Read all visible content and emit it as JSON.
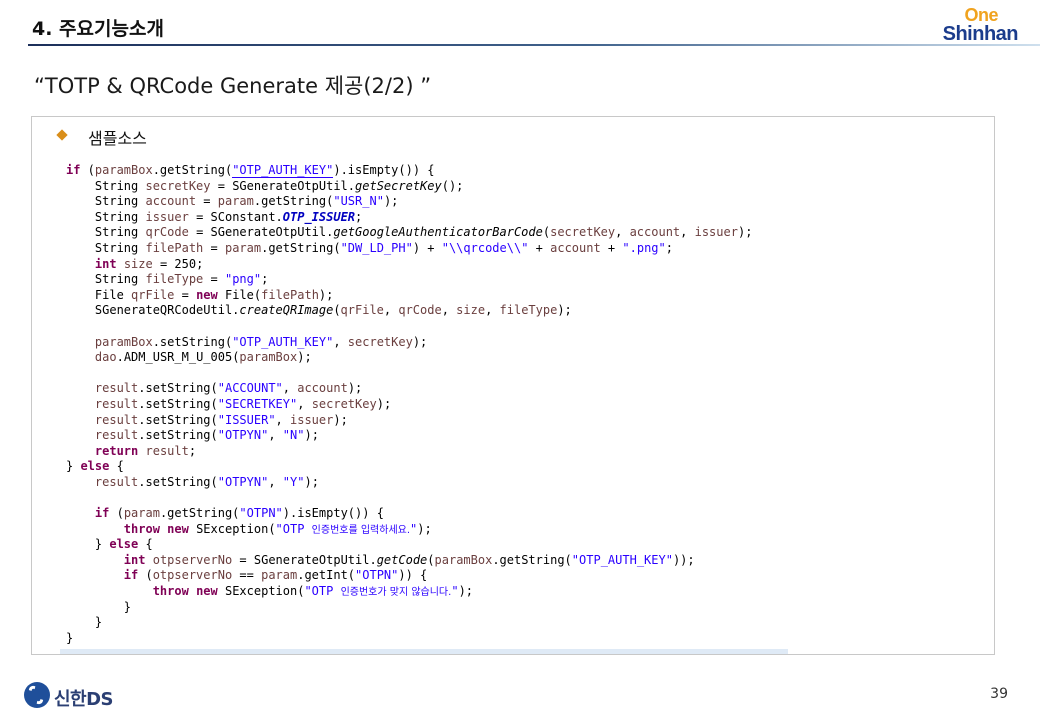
{
  "header": {
    "title": "4. 주요기능소개",
    "brand_one": "One",
    "brand_shinhan": "Shinhan"
  },
  "subtitle": "“TOTP & QRCode Generate 제공(2/2) ”",
  "section": {
    "label": "샘플소스"
  },
  "code_lines": [
    [
      [
        "kw",
        "if"
      ],
      [
        "p",
        " ("
      ],
      [
        "v",
        "paramBox"
      ],
      [
        "p",
        ".getString("
      ],
      [
        "sh",
        "\"OTP_AUTH_KEY\""
      ],
      [
        "p",
        ").isEmpty()) {"
      ]
    ],
    [
      [
        "p",
        "    String "
      ],
      [
        "v",
        "secretKey"
      ],
      [
        "p",
        " = SGenerateOtpUtil."
      ],
      [
        "i",
        "getSecretKey"
      ],
      [
        "p",
        "();"
      ]
    ],
    [
      [
        "p",
        "    String "
      ],
      [
        "v",
        "account"
      ],
      [
        "p",
        " = "
      ],
      [
        "v",
        "param"
      ],
      [
        "p",
        ".getString("
      ],
      [
        "s",
        "\"USR_N\""
      ],
      [
        "p",
        ");"
      ]
    ],
    [
      [
        "p",
        "    String "
      ],
      [
        "v",
        "issuer"
      ],
      [
        "p",
        " = SConstant."
      ],
      [
        "f",
        "OTP_ISSUER"
      ],
      [
        "p",
        ";"
      ]
    ],
    [
      [
        "p",
        "    String "
      ],
      [
        "v",
        "qrCode"
      ],
      [
        "p",
        " = SGenerateOtpUtil."
      ],
      [
        "i",
        "getGoogleAuthenticatorBarCode"
      ],
      [
        "p",
        "("
      ],
      [
        "v",
        "secretKey"
      ],
      [
        "p",
        ", "
      ],
      [
        "v",
        "account"
      ],
      [
        "p",
        ", "
      ],
      [
        "v",
        "issuer"
      ],
      [
        "p",
        ");"
      ]
    ],
    [
      [
        "p",
        "    String "
      ],
      [
        "v",
        "filePath"
      ],
      [
        "p",
        " = "
      ],
      [
        "v",
        "param"
      ],
      [
        "p",
        ".getString("
      ],
      [
        "s",
        "\"DW_LD_PH\""
      ],
      [
        "p",
        ") + "
      ],
      [
        "s",
        "\"\\\\qrcode\\\\\""
      ],
      [
        "p",
        " + "
      ],
      [
        "v",
        "account"
      ],
      [
        "p",
        " + "
      ],
      [
        "s",
        "\".png\""
      ],
      [
        "p",
        ";"
      ]
    ],
    [
      [
        "p",
        "    "
      ],
      [
        "kw",
        "int"
      ],
      [
        "p",
        " "
      ],
      [
        "v",
        "size"
      ],
      [
        "p",
        " = 250;"
      ]
    ],
    [
      [
        "p",
        "    String "
      ],
      [
        "v",
        "fileType"
      ],
      [
        "p",
        " = "
      ],
      [
        "s",
        "\"png\""
      ],
      [
        "p",
        ";"
      ]
    ],
    [
      [
        "p",
        "    File "
      ],
      [
        "v",
        "qrFile"
      ],
      [
        "p",
        " = "
      ],
      [
        "kw",
        "new"
      ],
      [
        "p",
        " File("
      ],
      [
        "v",
        "filePath"
      ],
      [
        "p",
        ");"
      ]
    ],
    [
      [
        "p",
        "    SGenerateQRCodeUtil."
      ],
      [
        "i",
        "createQRImage"
      ],
      [
        "p",
        "("
      ],
      [
        "v",
        "qrFile"
      ],
      [
        "p",
        ", "
      ],
      [
        "v",
        "qrCode"
      ],
      [
        "p",
        ", "
      ],
      [
        "v",
        "size"
      ],
      [
        "p",
        ", "
      ],
      [
        "v",
        "fileType"
      ],
      [
        "p",
        ");"
      ]
    ],
    [],
    [
      [
        "p",
        "    "
      ],
      [
        "v",
        "paramBox"
      ],
      [
        "p",
        ".setString("
      ],
      [
        "s",
        "\"OTP_AUTH_KEY\""
      ],
      [
        "p",
        ", "
      ],
      [
        "v",
        "secretKey"
      ],
      [
        "p",
        ");"
      ]
    ],
    [
      [
        "p",
        "    "
      ],
      [
        "v",
        "dao"
      ],
      [
        "p",
        ".ADM_USR_M_U_005("
      ],
      [
        "v",
        "paramBox"
      ],
      [
        "p",
        ");"
      ]
    ],
    [],
    [
      [
        "p",
        "    "
      ],
      [
        "v",
        "result"
      ],
      [
        "p",
        ".setString("
      ],
      [
        "s",
        "\"ACCOUNT\""
      ],
      [
        "p",
        ", "
      ],
      [
        "v",
        "account"
      ],
      [
        "p",
        ");"
      ]
    ],
    [
      [
        "p",
        "    "
      ],
      [
        "v",
        "result"
      ],
      [
        "p",
        ".setString("
      ],
      [
        "s",
        "\"SECRETKEY\""
      ],
      [
        "p",
        ", "
      ],
      [
        "v",
        "secretKey"
      ],
      [
        "p",
        ");"
      ]
    ],
    [
      [
        "p",
        "    "
      ],
      [
        "v",
        "result"
      ],
      [
        "p",
        ".setString("
      ],
      [
        "s",
        "\"ISSUER\""
      ],
      [
        "p",
        ", "
      ],
      [
        "v",
        "issuer"
      ],
      [
        "p",
        ");"
      ]
    ],
    [
      [
        "p",
        "    "
      ],
      [
        "v",
        "result"
      ],
      [
        "p",
        ".setString("
      ],
      [
        "s",
        "\"OTPYN\""
      ],
      [
        "p",
        ", "
      ],
      [
        "s",
        "\"N\""
      ],
      [
        "p",
        ");"
      ]
    ],
    [
      [
        "p",
        "    "
      ],
      [
        "kw",
        "return"
      ],
      [
        "p",
        " "
      ],
      [
        "v",
        "result"
      ],
      [
        "p",
        ";"
      ]
    ],
    [
      [
        "p",
        "} "
      ],
      [
        "kw",
        "else"
      ],
      [
        "p",
        " {"
      ]
    ],
    [
      [
        "p",
        "    "
      ],
      [
        "v",
        "result"
      ],
      [
        "p",
        ".setString("
      ],
      [
        "s",
        "\"OTPYN\""
      ],
      [
        "p",
        ", "
      ],
      [
        "s",
        "\"Y\""
      ],
      [
        "p",
        ");"
      ]
    ],
    [],
    [
      [
        "p",
        "    "
      ],
      [
        "kw",
        "if"
      ],
      [
        "p",
        " ("
      ],
      [
        "v",
        "param"
      ],
      [
        "p",
        ".getString("
      ],
      [
        "s",
        "\"OTPN\""
      ],
      [
        "p",
        ").isEmpty()) {"
      ]
    ],
    [
      [
        "p",
        "        "
      ],
      [
        "kw",
        "throw"
      ],
      [
        "p",
        " "
      ],
      [
        "kw",
        "new"
      ],
      [
        "p",
        " SException("
      ],
      [
        "s",
        "\"OTP "
      ],
      [
        "sk",
        "인증번호를 입력하세요."
      ],
      [
        "s",
        "\""
      ],
      [
        "p",
        ");"
      ]
    ],
    [
      [
        "p",
        "    } "
      ],
      [
        "kw",
        "else"
      ],
      [
        "p",
        " {"
      ]
    ],
    [
      [
        "p",
        "        "
      ],
      [
        "kw",
        "int"
      ],
      [
        "p",
        " "
      ],
      [
        "v",
        "otpserverNo"
      ],
      [
        "p",
        " = SGenerateOtpUtil."
      ],
      [
        "i",
        "getCode"
      ],
      [
        "p",
        "("
      ],
      [
        "v",
        "paramBox"
      ],
      [
        "p",
        ".getString("
      ],
      [
        "s",
        "\"OTP_AUTH_KEY\""
      ],
      [
        "p",
        "));"
      ]
    ],
    [
      [
        "p",
        "        "
      ],
      [
        "kw",
        "if"
      ],
      [
        "p",
        " ("
      ],
      [
        "v",
        "otpserverNo"
      ],
      [
        "p",
        " == "
      ],
      [
        "v",
        "param"
      ],
      [
        "p",
        ".getInt("
      ],
      [
        "s",
        "\"OTPN\""
      ],
      [
        "p",
        ")) {"
      ]
    ],
    [
      [
        "p",
        "            "
      ],
      [
        "kw",
        "throw"
      ],
      [
        "p",
        " "
      ],
      [
        "kw",
        "new"
      ],
      [
        "p",
        " SException("
      ],
      [
        "s",
        "\"OTP "
      ],
      [
        "sk",
        "인증번호가 맞지 않습니다."
      ],
      [
        "s",
        "\""
      ],
      [
        "p",
        ");"
      ]
    ],
    [
      [
        "p",
        "        }"
      ]
    ],
    [
      [
        "p",
        "    }"
      ]
    ],
    [
      [
        "p",
        "}"
      ]
    ]
  ],
  "footer": {
    "logo_text": "신한DS",
    "page_number": "39"
  },
  "colors": {
    "keyword": "#7f0055",
    "string": "#2a00ff",
    "field": "#0000c0",
    "variable": "#6a3e3e",
    "brand_orange": "#f0a31f",
    "brand_blue": "#1b3c8c",
    "bullet": "#d98e1a"
  }
}
